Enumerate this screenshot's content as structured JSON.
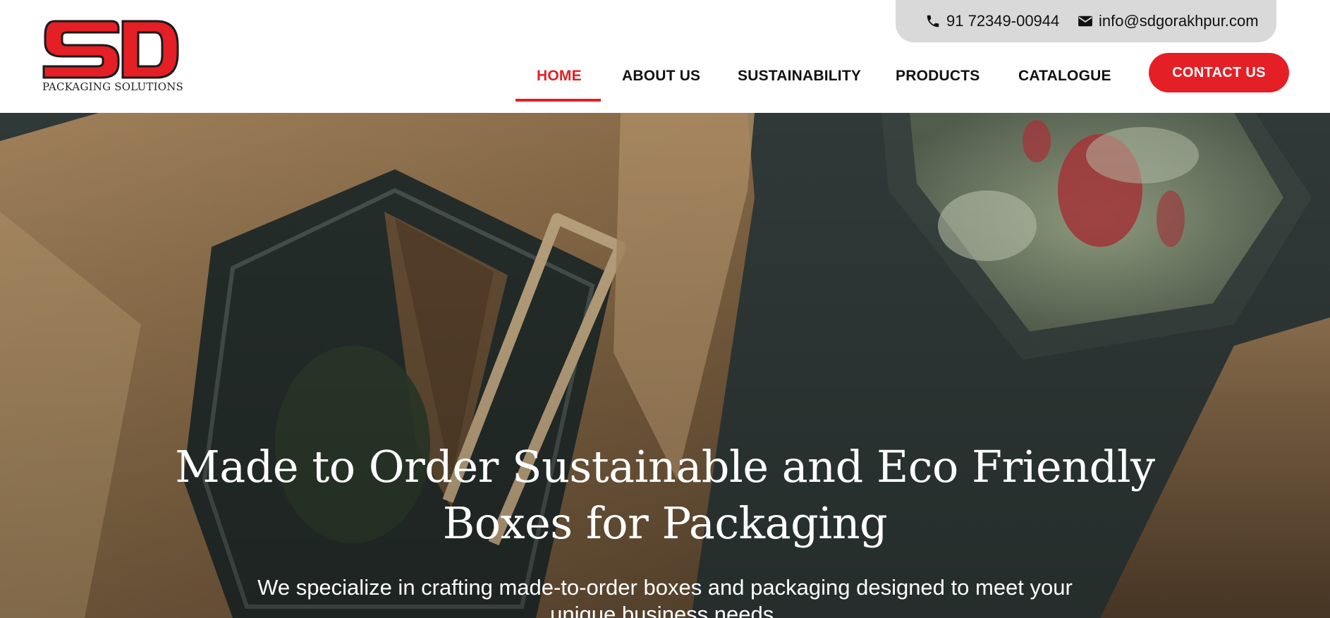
{
  "logo": {
    "letters": "SD",
    "tagline": "PACKAGING SOLUTIONS"
  },
  "topbar": {
    "phone": "91 72349-00944",
    "email": "info@sdgorakhpur.com"
  },
  "nav": {
    "items": [
      {
        "label": "HOME",
        "active": true
      },
      {
        "label": "ABOUT US",
        "active": false
      },
      {
        "label": "SUSTAINABILITY",
        "active": false
      },
      {
        "label": "PRODUCTS",
        "active": false
      },
      {
        "label": "CATALOGUE",
        "active": false
      }
    ],
    "cta": "CONTACT US"
  },
  "hero": {
    "title": "Made to Order Sustainable and Eco Friendly Boxes for Packaging",
    "subtitle": "We specialize in crafting made-to-order boxes and packaging designed to meet your unique business needs."
  },
  "colors": {
    "brand_red": "#e41f26",
    "topbar_bg": "#d9d9d9",
    "hero_bg": "#2e3836"
  },
  "icons": {
    "phone": "phone-icon",
    "email": "envelope-icon"
  }
}
